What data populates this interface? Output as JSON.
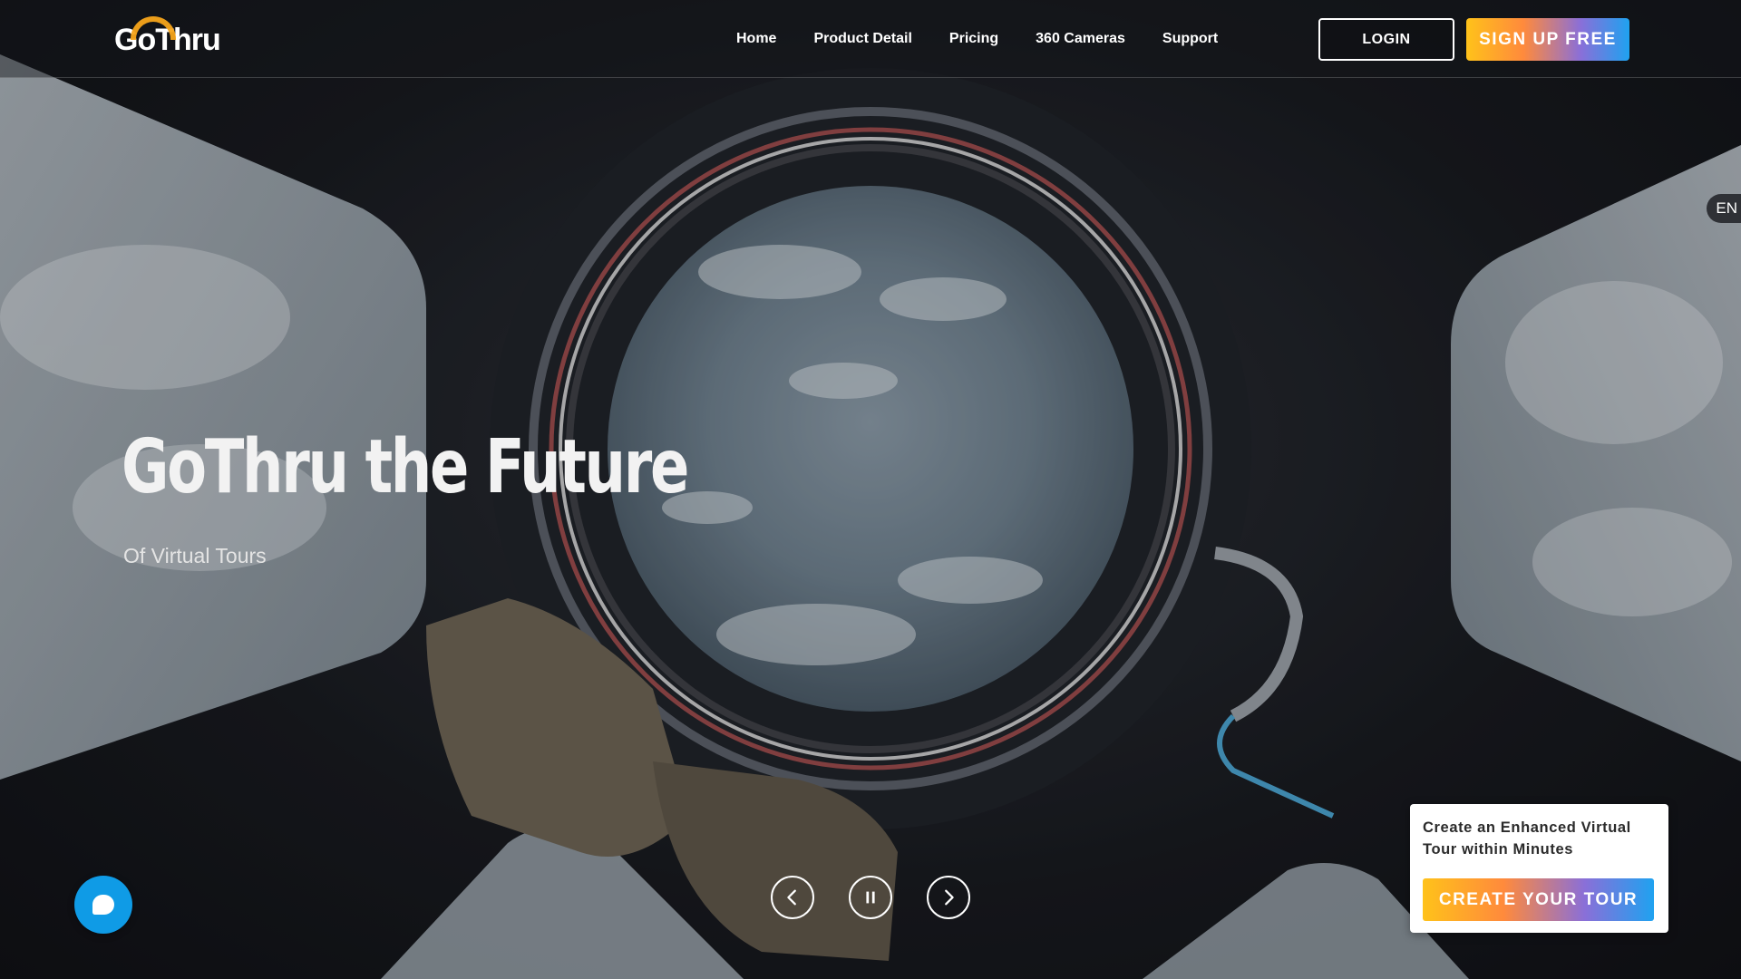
{
  "brand": {
    "logo_text": "GoThru"
  },
  "nav": {
    "items": [
      {
        "label": "Home"
      },
      {
        "label": "Product Detail"
      },
      {
        "label": "Pricing"
      },
      {
        "label": "360 Cameras"
      },
      {
        "label": "Support"
      }
    ],
    "login_label": "LOGIN",
    "signup_label": "SIGN UP FREE"
  },
  "language": {
    "current": "EN"
  },
  "hero": {
    "title": "GoThru the Future",
    "subtitle": "Of Virtual Tours"
  },
  "slider_controls": {
    "prev_icon": "chevron-left-icon",
    "pause_icon": "pause-icon",
    "next_icon": "chevron-right-icon"
  },
  "chat": {
    "icon": "chat-bubble-icon",
    "color": "#0f9be6"
  },
  "cta": {
    "text": "Create an Enhanced Virtual Tour within Minutes",
    "button_label": "CREATE YOUR TOUR"
  },
  "colors": {
    "gradient_start": "#ffc21a",
    "gradient_mid": "#ff8a3c",
    "gradient_end": "#1fa2f0"
  }
}
